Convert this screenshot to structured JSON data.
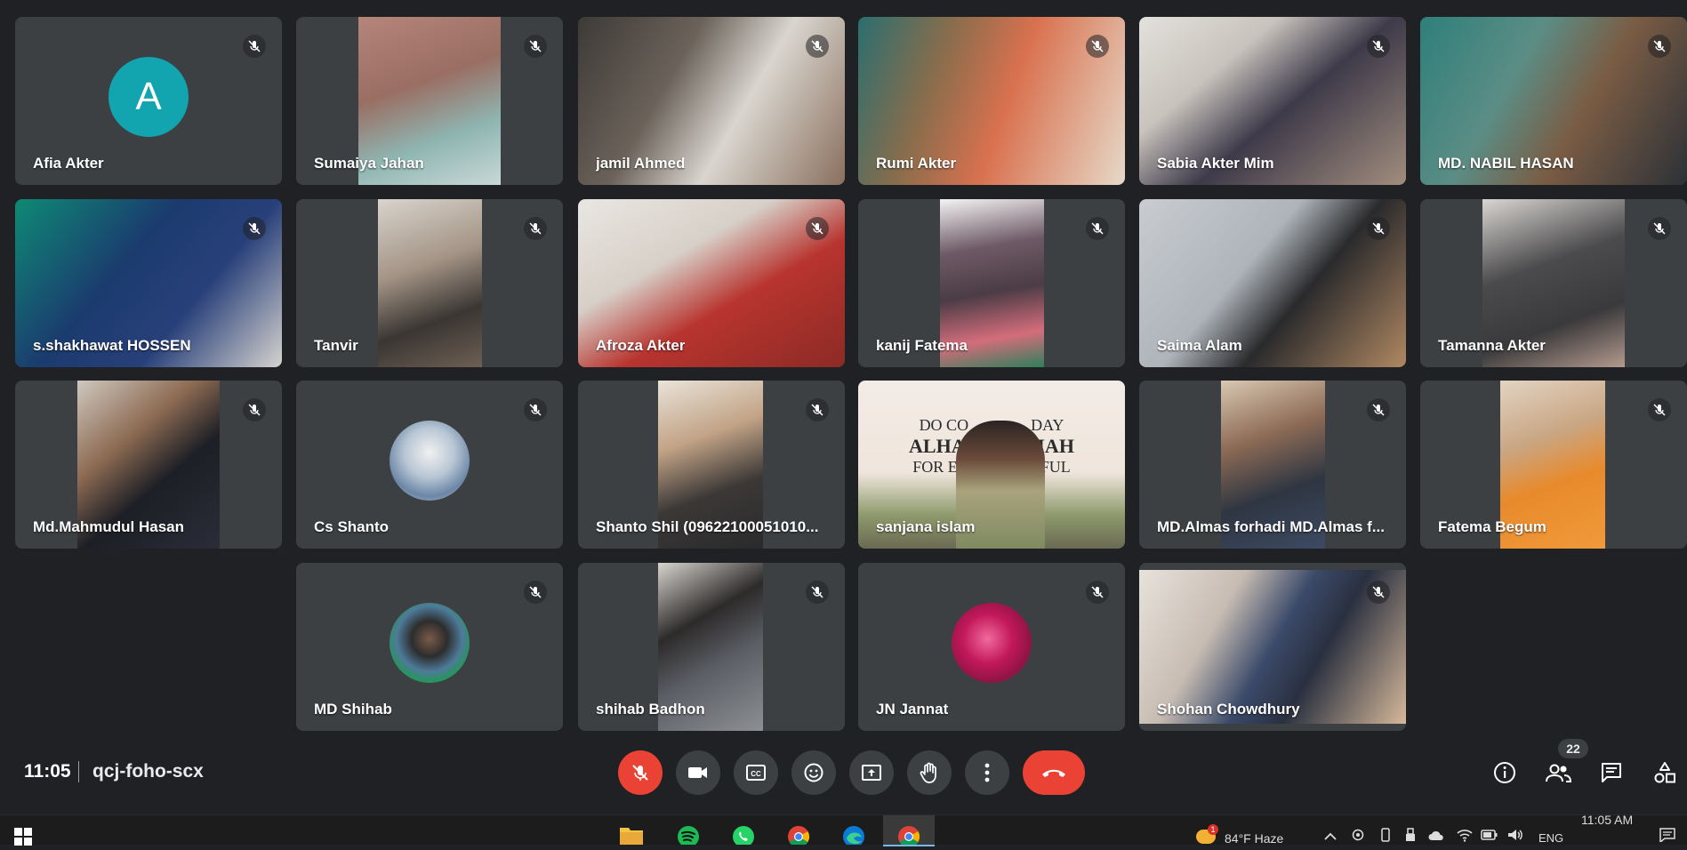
{
  "meeting": {
    "time": "11:05",
    "code": "qcj-foho-scx",
    "participant_count": "22"
  },
  "participants": [
    {
      "name": "Afia Akter"
    },
    {
      "name": "Sumaiya Jahan"
    },
    {
      "name": "jamil Ahmed"
    },
    {
      "name": "Rumi Akter"
    },
    {
      "name": "Sabia Akter Mim"
    },
    {
      "name": "MD. NABIL HASAN"
    },
    {
      "name": "s.shakhawat HOSSEN"
    },
    {
      "name": "Tanvir"
    },
    {
      "name": "Afroza Akter"
    },
    {
      "name": "kanij Fatema"
    },
    {
      "name": "Saima Alam"
    },
    {
      "name": "Tamanna Akter"
    },
    {
      "name": "Md.Mahmudul Hasan"
    },
    {
      "name": "Cs Shanto"
    },
    {
      "name": "Shanto Shil (09622100051010..."
    },
    {
      "name": "sanjana islam"
    },
    {
      "name": "MD.Almas forhadi MD.Almas f..."
    },
    {
      "name": "Fatema Begum"
    },
    {
      "name": "MD Shihab"
    },
    {
      "name": "shihab Badhon"
    },
    {
      "name": "JN Jannat"
    },
    {
      "name": "Shohan Chowdhury"
    }
  ],
  "avatar_initial": "A",
  "background_text": {
    "line1": "DO CO",
    "line1b": "DAY",
    "line2": "ALHAM",
    "line2b": "IAH",
    "line3": "FOR EV",
    "line3b": "SSFUL"
  },
  "controls": [
    "mic-off",
    "camera",
    "captions",
    "emoji",
    "present",
    "raise-hand",
    "more",
    "end-call"
  ],
  "taskbar": {
    "weather": "84°F Haze",
    "lang": "ENG",
    "time": "11:05 AM",
    "notification_badge": "1"
  },
  "colors": {
    "background": "#202124",
    "tile": "#3c4043",
    "end_call": "#ea4335",
    "avatar_a": "#12a4af"
  }
}
